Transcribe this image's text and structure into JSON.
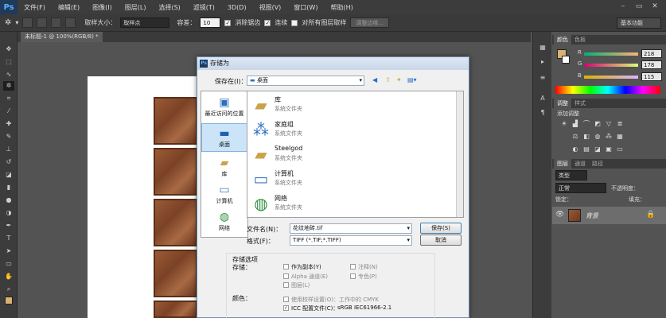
{
  "app": {
    "logo": "Ps"
  },
  "menu": [
    "文件(F)",
    "编辑(E)",
    "图像(I)",
    "图层(L)",
    "选择(S)",
    "滤镜(T)",
    "3D(D)",
    "视图(V)",
    "窗口(W)",
    "帮助(H)"
  ],
  "options": {
    "feather_label": "取样大小：",
    "sample_value": "取样点",
    "tolerance_label": "容差：",
    "tolerance_value": "10",
    "antialias_label": "消除锯齿",
    "contiguous_label": "连续",
    "sample_all_label": "对所有图层取样",
    "refine_edge_label": "调整边缘...",
    "workspace": "基本功能"
  },
  "document": {
    "tab_title": "未标题-1 @ 100%(RGB/8) *"
  },
  "panels": {
    "color_tabs": [
      "颜色",
      "色板"
    ],
    "r_label": "R",
    "g_label": "G",
    "b_label": "B",
    "r_value": "218",
    "g_value": "178",
    "b_value": "115",
    "adjust_tabs": [
      "调整",
      "样式"
    ],
    "adjust_title": "添加调整",
    "layer_tabs": [
      "图层",
      "通道",
      "路径"
    ],
    "kind_label": "类型",
    "blend_mode": "正常",
    "opacity_label": "不透明度：",
    "lock_label": "锁定：",
    "fill_label": "填充：",
    "layer_name": "背景"
  },
  "dialog": {
    "title": "存储为",
    "save_in_label": "保存在(I)：",
    "save_in_value": "桌面",
    "places": [
      "最近访问的位置",
      "桌面",
      "库",
      "计算机",
      "网络"
    ],
    "files": [
      {
        "name": "库",
        "type": "系统文件夹",
        "icon": "library-folder-icon"
      },
      {
        "name": "家庭组",
        "type": "系统文件夹",
        "icon": "homegroup-icon"
      },
      {
        "name": "Steelgod",
        "type": "系统文件夹",
        "icon": "user-folder-icon"
      },
      {
        "name": "计算机",
        "type": "系统文件夹",
        "icon": "computer-icon"
      },
      {
        "name": "网络",
        "type": "系统文件夹",
        "icon": "network-icon"
      }
    ],
    "filename_label": "文件名(N)：",
    "filename_value": "花纹地砖.tif",
    "format_label": "格式(F)：",
    "format_value": "TIFF (*.TIF;*.TIFF)",
    "save_button": "保存(S)",
    "cancel_button": "取消",
    "save_options_label": "存储选项",
    "save_label": "存储：",
    "as_copy": "作为副本(Y)",
    "notes": "注释(N)",
    "alpha": "Alpha 通道(E)",
    "spot": "专色(P)",
    "layers": "图层(L)",
    "color_label": "颜色：",
    "use_proof": "使用校样设置(O)：",
    "proof_value": "工作中的 CMYK",
    "icc": "ICC 配置文件(C)：",
    "icc_value": "sRGB IEC61966-2.1"
  },
  "colors": {
    "foreground": "#dab273",
    "background": "#ffffff",
    "accent": "#3c7fb1"
  }
}
